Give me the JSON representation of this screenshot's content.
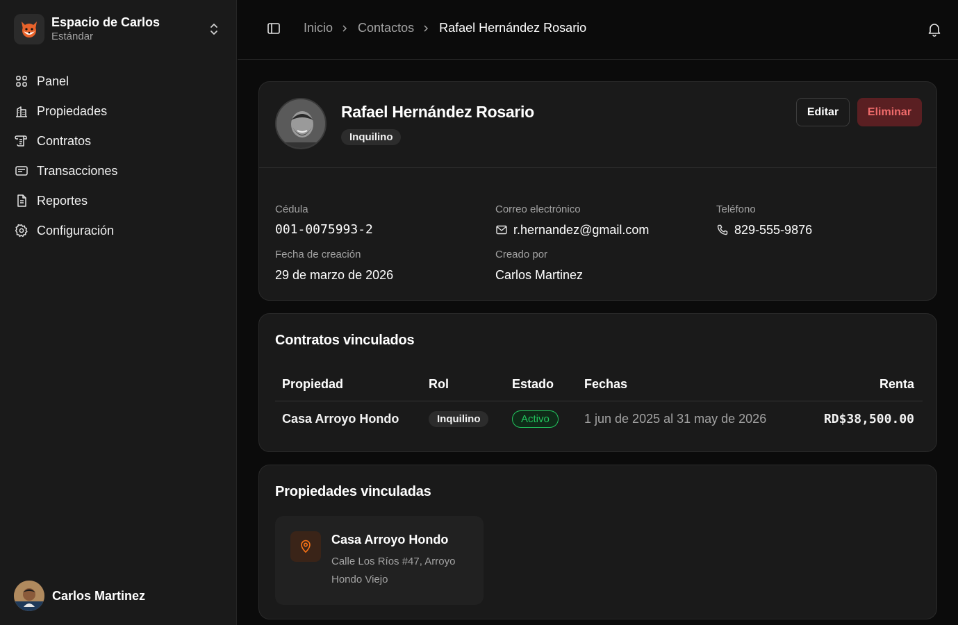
{
  "workspace": {
    "name": "Espacio de Carlos",
    "plan": "Estándar"
  },
  "nav": {
    "items": [
      {
        "label": "Panel",
        "icon": "grid-icon"
      },
      {
        "label": "Propiedades",
        "icon": "building-icon"
      },
      {
        "label": "Contratos",
        "icon": "scroll-icon"
      },
      {
        "label": "Transacciones",
        "icon": "receipt-icon"
      },
      {
        "label": "Reportes",
        "icon": "file-text-icon"
      },
      {
        "label": "Configuración",
        "icon": "gear-icon"
      }
    ]
  },
  "user": {
    "name": "Carlos Martinez"
  },
  "breadcrumb": {
    "home": "Inicio",
    "section": "Contactos",
    "current": "Rafael Hernández Rosario"
  },
  "contact": {
    "name": "Rafael Hernández Rosario",
    "type_badge": "Inquilino",
    "edit_label": "Editar",
    "delete_label": "Eliminar",
    "fields": {
      "id_label": "Cédula",
      "id_value": "001-0075993-2",
      "email_label": "Correo electrónico",
      "email_value": "r.hernandez@gmail.com",
      "phone_label": "Teléfono",
      "phone_value": "829-555-9876",
      "created_label": "Fecha de creación",
      "created_value": "29 de marzo de 2026",
      "creator_label": "Creado por",
      "creator_value": "Carlos Martinez"
    }
  },
  "contracts": {
    "title": "Contratos vinculados",
    "columns": [
      "Propiedad",
      "Rol",
      "Estado",
      "Fechas",
      "Renta"
    ],
    "rows": [
      {
        "property": "Casa Arroyo Hondo",
        "role": "Inquilino",
        "status": "Activo",
        "dates": "1 jun de 2025 al 31 may de 2026",
        "rent": "RD$38,500.00"
      }
    ]
  },
  "properties": {
    "title": "Propiedades vinculadas",
    "items": [
      {
        "name": "Casa Arroyo Hondo",
        "address": "Calle Los Ríos #47, Arroyo Hondo Viejo"
      }
    ]
  },
  "colors": {
    "accent_orange": "#f97316",
    "status_green": "#22c55e",
    "danger": "#f06b6b"
  }
}
